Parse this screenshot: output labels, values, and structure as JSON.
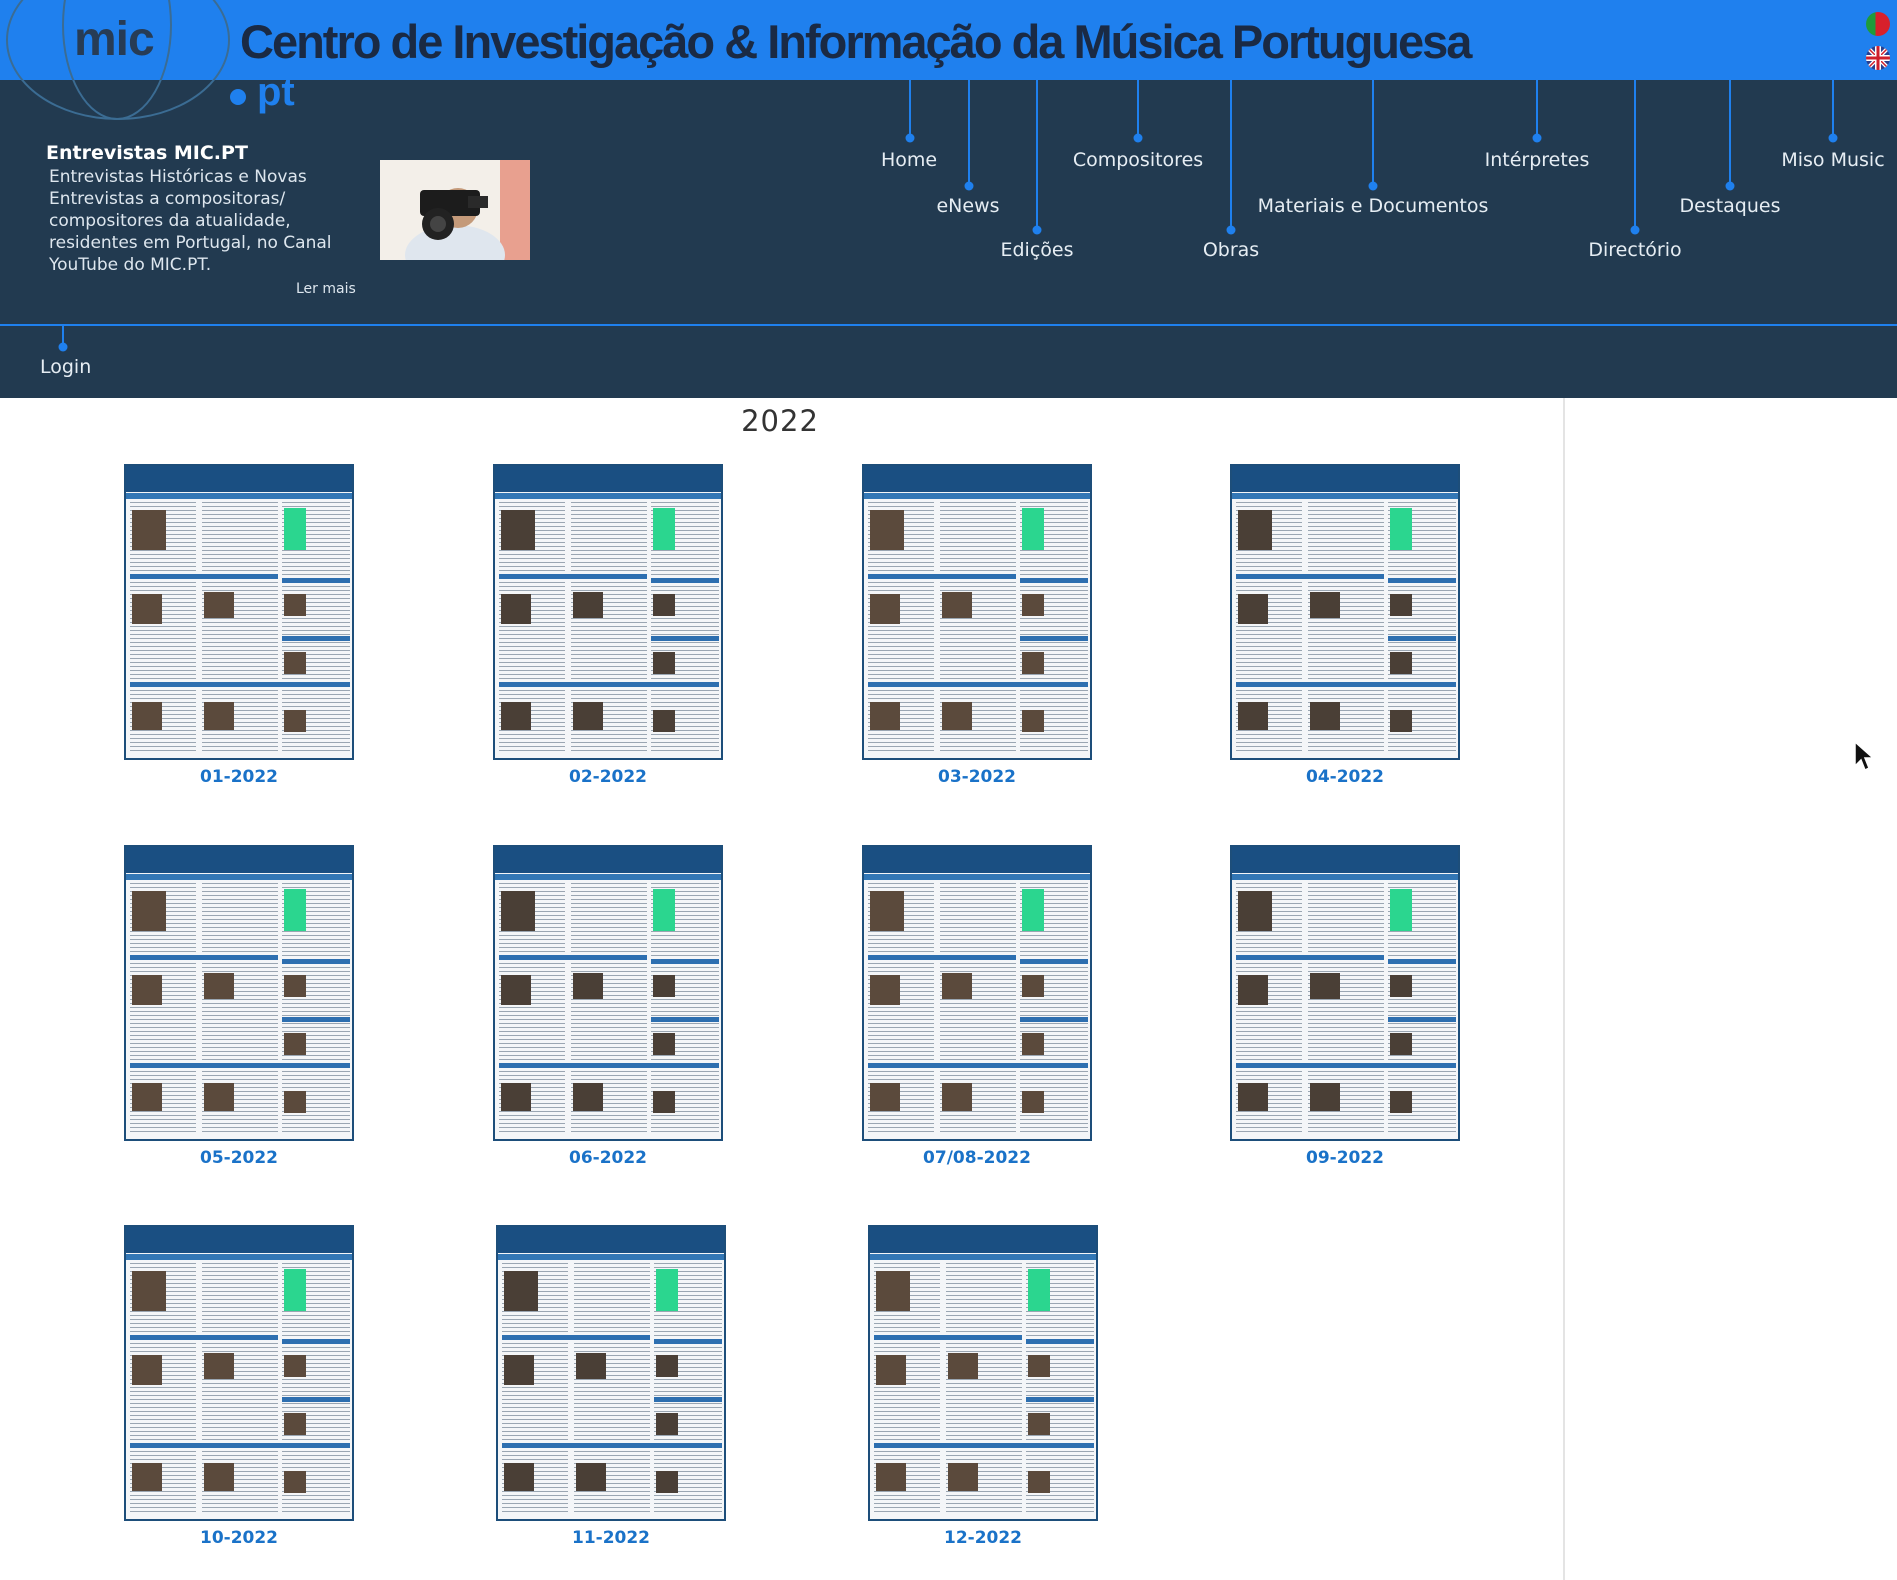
{
  "banner": {
    "title": "Centro de Investigação & Informação da Música Portuguesa"
  },
  "logo": {
    "main": "mic",
    "suffix": "pt"
  },
  "promo": {
    "title": "Entrevistas MIC.PT",
    "text": "Entrevistas Históricas e Novas Entrevistas a compositoras/ compositores da atualidade, residentes em Portugal, no Canal YouTube do MIC.PT.",
    "more": "Ler mais"
  },
  "nav": {
    "home": "Home",
    "enews": "eNews",
    "edicoes": "Edições",
    "compositores": "Compositores",
    "obras": "Obras",
    "materiais": "Materiais e Documentos",
    "interpretes": "Intérpretes",
    "directorio": "Directório",
    "destaques": "Destaques",
    "miso": "Miso Music"
  },
  "subnav": {
    "login": "Login"
  },
  "main": {
    "year": "2022",
    "issues": [
      {
        "label": "01-2022"
      },
      {
        "label": "02-2022"
      },
      {
        "label": "03-2022"
      },
      {
        "label": "04-2022"
      },
      {
        "label": "05-2022"
      },
      {
        "label": "06-2022"
      },
      {
        "label": "07/08-2022"
      },
      {
        "label": "09-2022"
      },
      {
        "label": "10-2022"
      },
      {
        "label": "11-2022"
      },
      {
        "label": "12-2022"
      }
    ]
  },
  "languages": [
    "flag-portugal-icon",
    "flag-uk-icon"
  ],
  "colors": {
    "banner": "#1f80ee",
    "header": "#223a50",
    "link": "#1a72c8"
  }
}
